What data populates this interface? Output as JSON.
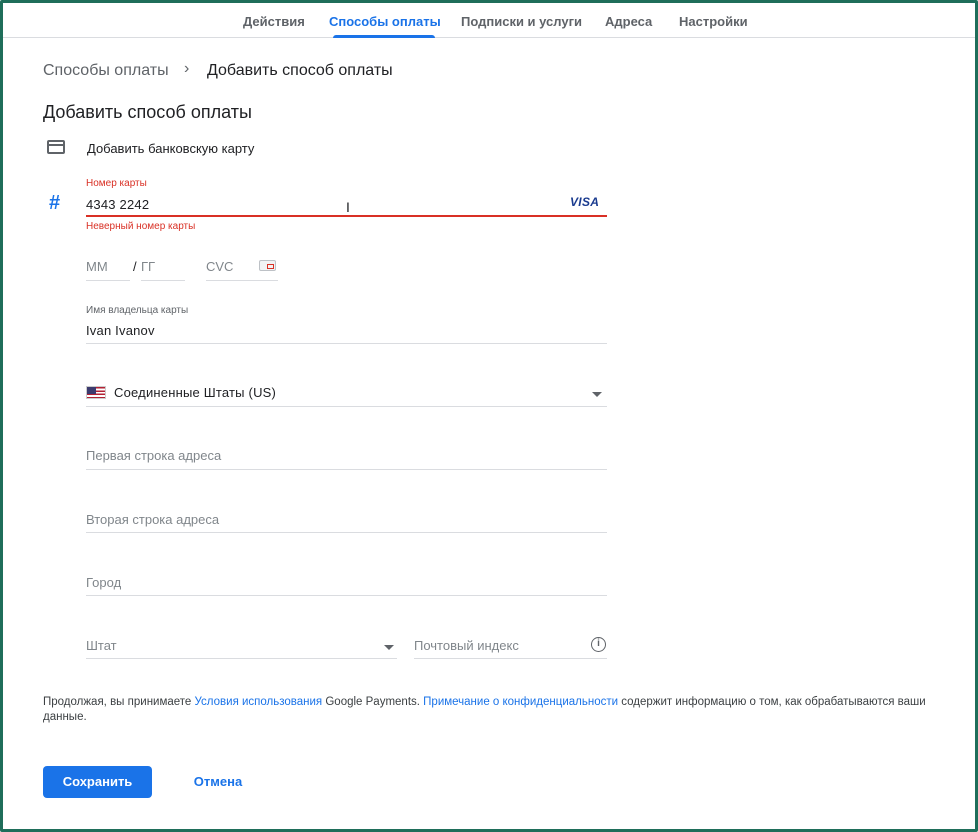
{
  "nav": {
    "tabs": [
      {
        "label": "Действия"
      },
      {
        "label": "Способы оплаты",
        "active": true
      },
      {
        "label": "Подписки и услуги"
      },
      {
        "label": "Адреса"
      },
      {
        "label": "Настройки"
      }
    ]
  },
  "breadcrumb": {
    "parent": "Способы оплаты",
    "separator": "›",
    "current": "Добавить способ оплаты"
  },
  "page": {
    "title": "Добавить способ оплаты",
    "add_card_label": "Добавить банковскую карту"
  },
  "card_form": {
    "number_label": "Номер карты",
    "number_value": "4343  2242",
    "number_error": "Неверный номер карты",
    "brand": "VISA",
    "month_placeholder": "ММ",
    "year_separator": "/",
    "year_placeholder": "ГГ",
    "cvc_placeholder": "CVC",
    "holder_label": "Имя владельца карты",
    "holder_value": "Ivan Ivanov"
  },
  "address_form": {
    "country": "Соединенные Штаты (US)",
    "address_line1_placeholder": "Первая строка адреса",
    "address_line2_placeholder": "Вторая строка адреса",
    "city_placeholder": "Город",
    "state_placeholder": "Штат",
    "zip_placeholder": "Почтовый индекс",
    "info_icon_glyph": "i"
  },
  "terms": {
    "text_before": "Продолжая, вы принимаете ",
    "terms_link": "Условия использования",
    "text_middle": " Google Payments. ",
    "privacy_link": "Примечание о конфиденциальности",
    "text_after": " содержит информацию о том, как обрабатываются ваши данные."
  },
  "buttons": {
    "save": "Сохранить",
    "cancel": "Отмена"
  },
  "icons": {
    "card": "credit-card-icon",
    "hash": "#",
    "cursor": "I"
  },
  "colors": {
    "accent": "#1a73e8",
    "error": "#d93025",
    "text": "#202124",
    "muted": "#5f6368",
    "frame": "#1f6e5a"
  }
}
